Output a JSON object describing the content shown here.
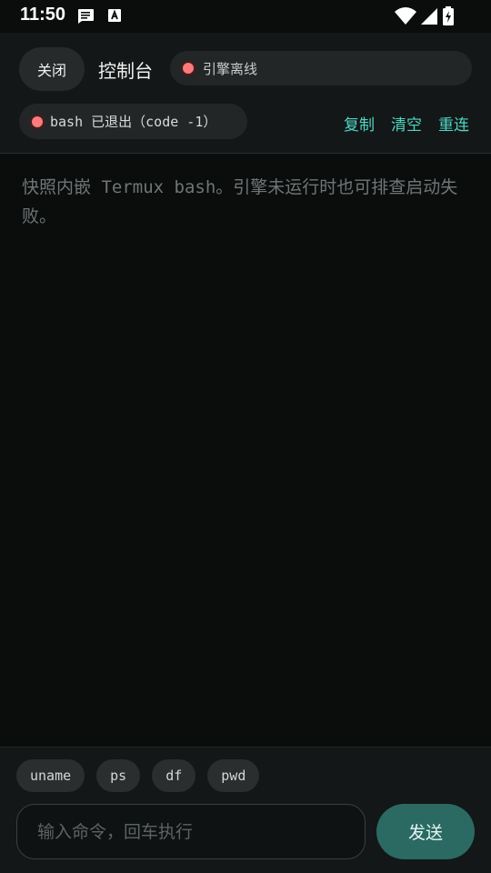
{
  "status_bar": {
    "time": "11:50",
    "icons": [
      "message-icon",
      "a-icon",
      "wifi-icon",
      "signal-icon",
      "battery-charging-icon"
    ]
  },
  "header": {
    "close_label": "关闭",
    "title": "控制台",
    "engine_status": "引擎离线",
    "session_status": "bash 已退出（code -1）",
    "actions": [
      "复制",
      "清空",
      "重连"
    ]
  },
  "terminal": {
    "text": "快照内嵌 Termux bash。引擎未运行时也可排查启动失败。"
  },
  "quick_commands": [
    "uname",
    "ps",
    "df",
    "pwd"
  ],
  "input": {
    "placeholder": "输入命令，回车执行",
    "value": ""
  },
  "send_label": "发送",
  "colors": {
    "accent": "#4fd6c4",
    "status_offline": "#ff7a7a",
    "send_button": "#2a6a63"
  }
}
